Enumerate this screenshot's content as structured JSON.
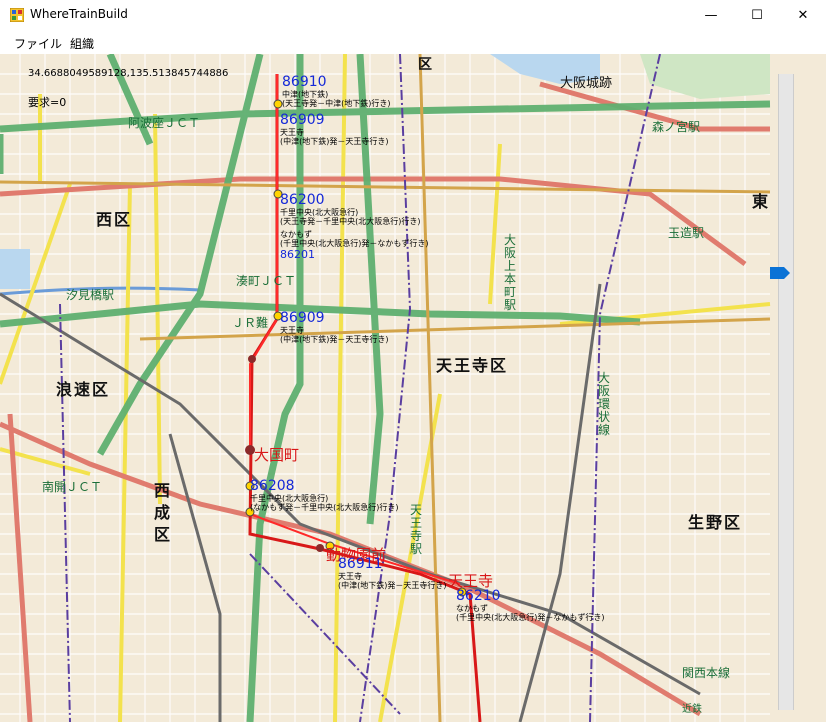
{
  "window": {
    "title": "WhereTrainBuild",
    "min_glyph": "—",
    "max_glyph": "☐",
    "close_glyph": "✕"
  },
  "menu": {
    "items": [
      "ファイル",
      "組織"
    ]
  },
  "map": {
    "coord_text": "34.6688049589128,135.513845744886",
    "request_text": "要求=0",
    "slider_level": 0.31,
    "ward_labels": [
      "西区",
      "浪速区",
      "天王寺区",
      "生野区",
      "東",
      "区"
    ],
    "ward_vertical": "西成区",
    "station_labels": [
      "大阪城跡",
      "森ノ宮駅",
      "玉造駅",
      "阿波座ＪＣＴ",
      "汐見橋駅",
      "湊町ＪＣＴ",
      "ＪＲ難",
      "大阪上本町駅",
      "大阪環状線",
      "南開ＪＣＴ",
      "天王寺駅",
      "関西本線",
      "近鉄"
    ],
    "highlighted_stations": [
      "大国町",
      "動物園前",
      "天王寺"
    ],
    "trains": [
      {
        "number": "86910",
        "lines": [
          "中津(地下鉄)",
          "(天王寺発－中津(地下鉄)行き)"
        ]
      },
      {
        "number": "86909",
        "lines": [
          "天王寺",
          "(中津(地下鉄)発－天王寺行き)"
        ]
      },
      {
        "number": "86200",
        "lines": [
          "千里中央(北大阪急行)",
          "(天王寺発－千里中央(北大阪急行)行き)"
        ]
      },
      {
        "number": "86201",
        "lines": [
          "なかもず",
          "(千里中央(北大阪急行)発－なかもず行き)"
        ]
      },
      {
        "number": "86909",
        "lines": [
          "天王寺",
          "(中津(地下鉄)発－天王寺行き)"
        ]
      },
      {
        "number": "86208",
        "lines": [
          "千里中央(北大阪急行)",
          "(なかもず発－千里中央(北大阪急行)行き)"
        ]
      },
      {
        "number": "86911",
        "lines": [
          "天王寺",
          "(中津(地下鉄)発－天王寺行き)"
        ]
      },
      {
        "number": "86210",
        "lines": [
          "なかもず",
          "(千里中央(北大阪急行)発－なかもず行き)"
        ]
      }
    ],
    "road_colors": {
      "expressway": "#5fb070",
      "national": "#e07b6e",
      "prefectural": "#f3e24d",
      "subway": "#d81818"
    }
  }
}
